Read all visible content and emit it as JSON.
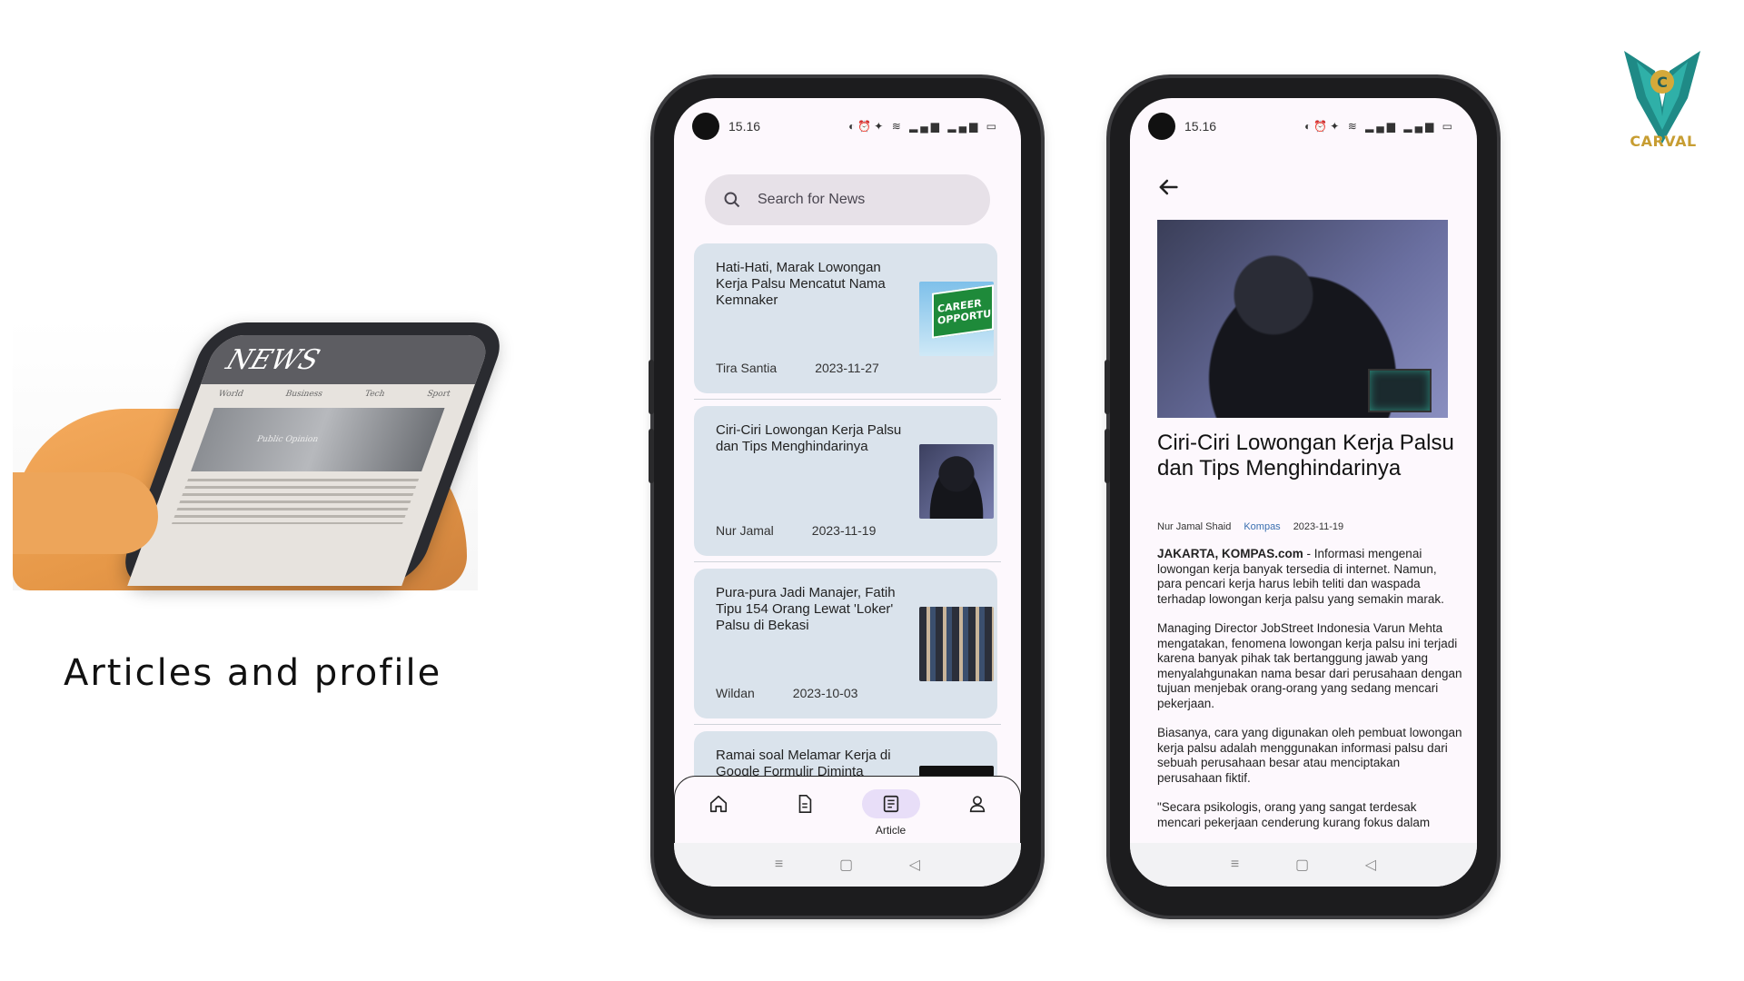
{
  "caption": "Articles and profile",
  "hero_news": {
    "masthead": "NEWS",
    "tabs": [
      "World",
      "Business",
      "Tech",
      "Sport"
    ],
    "image_caption": "Public Opinion"
  },
  "logo": {
    "text": "CARVAL"
  },
  "phone_list": {
    "time": "15.16",
    "search_placeholder": "Search for News",
    "articles": [
      {
        "title": "Hati-Hati, Marak Lowongan Kerja Palsu Mencatut Nama Kemnaker",
        "author": "Tira Santia",
        "date": "2023-11-27",
        "thumb_text": "CAREER OPPORTU"
      },
      {
        "title": "Ciri-Ciri Lowongan Kerja Palsu dan Tips Menghindarinya",
        "author": "Nur Jamal",
        "date": "2023-11-19"
      },
      {
        "title": "Pura-pura Jadi Manajer, Fatih Tipu 154 Orang Lewat 'Loker' Palsu di Bekasi",
        "author": "Wildan",
        "date": "2023-10-03"
      },
      {
        "title": "Ramai soal Melamar Kerja di Google Formulir Diminta",
        "author": "",
        "date": ""
      }
    ],
    "nav": {
      "active_label": "Article"
    }
  },
  "phone_article": {
    "time": "15.16",
    "title": "Ciri-Ciri Lowongan Kerja Palsu dan Tips Menghindarinya",
    "author": "Nur Jamal Shaid",
    "source": "Kompas",
    "date": "2023-11-19",
    "dateline": "JAKARTA, KOMPAS.com",
    "lead": " - Informasi mengenai lowongan kerja banyak tersedia di internet. Namun, para pencari kerja harus lebih teliti dan waspada terhadap lowongan kerja palsu yang semakin marak.",
    "para2": "Managing Director JobStreet Indonesia Varun Mehta mengatakan, fenomena lowongan kerja palsu ini terjadi karena banyak pihak tak bertanggung jawab yang menyalahgunakan nama besar dari perusahaan dengan tujuan menjebak orang-orang yang sedang mencari pekerjaan.",
    "para3": "Biasanya, cara yang digunakan oleh pembuat lowongan kerja palsu adalah menggunakan informasi palsu dari sebuah perusahaan besar atau menciptakan perusahaan fiktif.",
    "para4": "\"Secara psikologis, orang yang sangat terdesak mencari pekerjaan cenderung kurang fokus dalam"
  },
  "colors": {
    "card_bg": "#dae3ec",
    "active_pill": "#e8def8",
    "search_bg": "#e7e1e8",
    "source_link": "#3a6fb0"
  }
}
